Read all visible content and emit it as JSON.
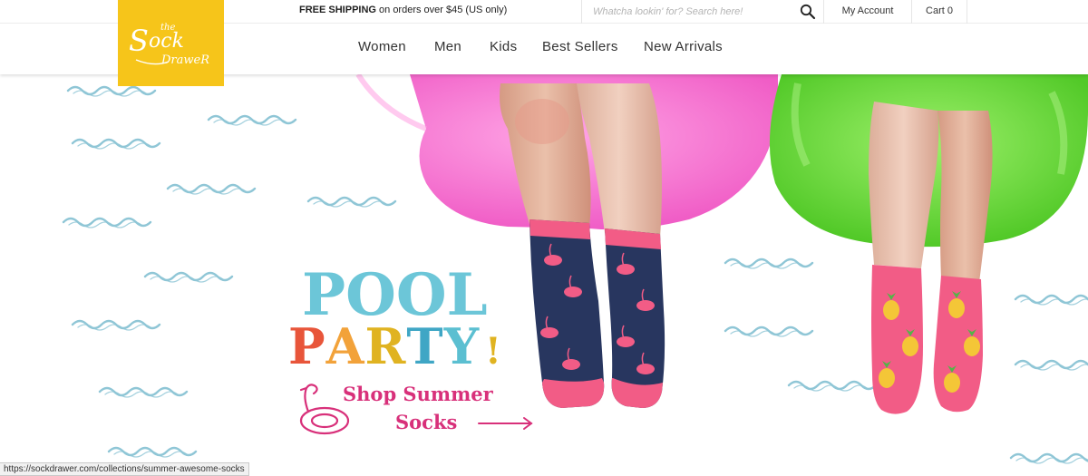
{
  "header": {
    "logo_text": "the Sock Drawer",
    "shipping_bold": "FREE SHIPPING",
    "shipping_rest": " on orders over $45 (US only)",
    "search": {
      "placeholder": "Whatcha lookin' for? Search here!"
    },
    "account_label": "My Account",
    "cart_label": "Cart 0"
  },
  "nav": {
    "items": [
      "Women",
      "Men",
      "Kids",
      "Best Sellers",
      "New Arrivals"
    ]
  },
  "hero": {
    "headline_pool": "POOL",
    "headline_party": [
      "P",
      "A",
      "R",
      "T",
      "Y",
      "!"
    ],
    "party_colors": [
      "#e8553a",
      "#f2a23a",
      "#e0b321",
      "#3fa6c5",
      "#5bbfd1",
      "#e0b321"
    ],
    "pool_color": "#6cc6d8",
    "cta_line1": "Shop Summer",
    "cta_line2": "Socks",
    "cta_color": "#d8307a"
  },
  "status_url": "https://sockdrawer.com/collections/summer-awesome-socks",
  "colors": {
    "logo_bg": "#f6c51a",
    "wave": "#8fc6d6",
    "pink_float": "#f57ad3",
    "green_float": "#6edc3c",
    "navy_sock": "#28365f",
    "pink_sock": "#f25c86"
  }
}
